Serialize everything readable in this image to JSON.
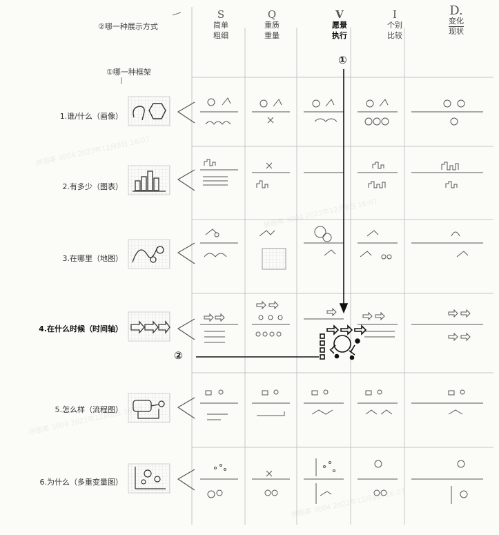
{
  "header": {
    "title_mode": "②哪一种展示方式",
    "title_frame": "①哪一种框架",
    "columns": [
      {
        "letter": "S",
        "line1": "简单",
        "line2": "粗细"
      },
      {
        "letter": "Q",
        "line1": "重质",
        "line2": "重量"
      },
      {
        "letter": "V",
        "line1": "愿景",
        "line2": "执行"
      },
      {
        "letter": "I",
        "line1": "个别",
        "line2": "比较"
      },
      {
        "letter": "D.",
        "line1": "变化",
        "line2": "现状"
      }
    ]
  },
  "rows": [
    {
      "label": "1.谁/什么（画像）"
    },
    {
      "label": "2.有多少（图表）"
    },
    {
      "label": "3.在哪里（地图）"
    },
    {
      "label": "4.在什么时候（时间轴）"
    },
    {
      "label": "5.怎么样（流程图）"
    },
    {
      "label": "6.为什么（多重变量图）"
    }
  ],
  "annotations": {
    "marker_1": "①",
    "marker_2": "②"
  },
  "watermark": "拼图客 3004 2022年12月8日 16:07",
  "colors": {
    "ink": "#2b2b2b",
    "grid": "#bdbdbd",
    "paper": "#fbfbf8"
  }
}
